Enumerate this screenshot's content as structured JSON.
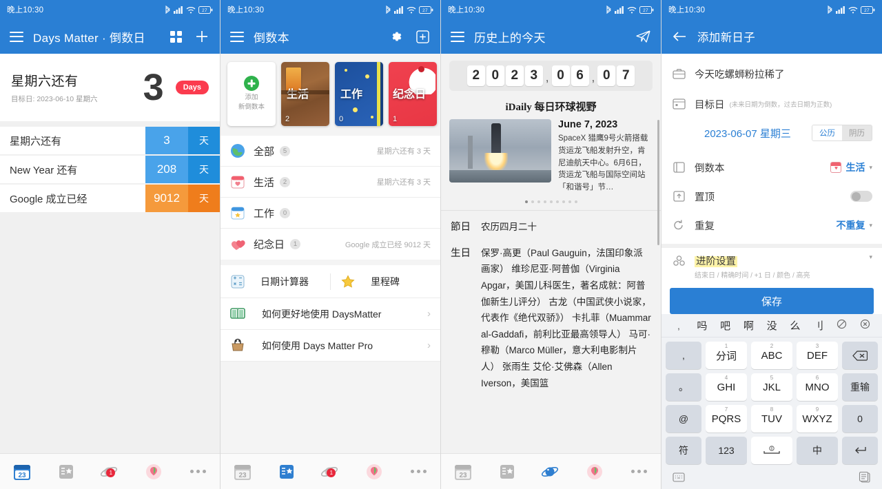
{
  "status_bar": {
    "time": "晚上10:30",
    "battery": "27",
    "icons": [
      "bluetooth-icon",
      "signal-icon",
      "wifi-icon",
      "battery-icon"
    ]
  },
  "panel1": {
    "appbar": {
      "title": "Days Matter · 倒数日",
      "menu_icon": "hamburger-icon",
      "grid_icon": "grid-view-icon",
      "add_icon": "plus-icon"
    },
    "hero": {
      "title": "星期六还有",
      "subtitle": "目标日: 2023-06-10 星期六",
      "number": "3",
      "pill": "Days"
    },
    "rows": [
      {
        "label": "星期六还有",
        "value": "3",
        "unit": "天",
        "num_bg": "#49a3ea",
        "unit_bg": "#1f8ddb"
      },
      {
        "label": "New Year 还有",
        "value": "208",
        "unit": "天",
        "num_bg": "#49a3ea",
        "unit_bg": "#1f8ddb"
      },
      {
        "label": "Google 成立已经",
        "value": "9012",
        "unit": "天",
        "num_bg": "#f59a3c",
        "unit_bg": "#ef7d1c"
      }
    ],
    "dock": {
      "items": [
        "calendar-23-icon",
        "star-book-icon",
        "planet-icon",
        "balloon-icon",
        "more-dots-icon"
      ],
      "badge": "1"
    }
  },
  "panel2": {
    "appbar": {
      "title": "倒数本",
      "menu_icon": "hamburger-icon",
      "settings_icon": "gear-icon",
      "add_icon": "plus-box-icon"
    },
    "books": [
      {
        "name": "添加",
        "name2": "新倒数本",
        "type": "add"
      },
      {
        "name": "生活",
        "count": "2",
        "type": "life"
      },
      {
        "name": "工作",
        "count": "0",
        "type": "work"
      },
      {
        "name": "纪念日",
        "count": "1",
        "type": "anniversary"
      }
    ],
    "categories": [
      {
        "icon": "globe-icon",
        "name": "全部",
        "badge": "5",
        "right": "星期六还有 3 天"
      },
      {
        "icon": "calendar-heart-icon",
        "name": "生活",
        "badge": "2",
        "right": "星期六还有 3 天"
      },
      {
        "icon": "calendar-star-icon",
        "name": "工作",
        "badge": "0",
        "right": ""
      },
      {
        "icon": "hearts-icon",
        "name": "纪念日",
        "badge": "1",
        "right": "Google 成立已经 9012 天"
      }
    ],
    "tools": [
      {
        "icon": "calculator-icon",
        "label": "日期计算器"
      },
      {
        "icon": "star-icon",
        "label": "里程碑"
      }
    ],
    "links": [
      {
        "icon": "book-icon",
        "label": "如何更好地使用 DaysMatter",
        "chevron": "›"
      },
      {
        "icon": "bag-icon",
        "label": "如何使用 Days Matter Pro",
        "chevron": "›"
      }
    ],
    "dock": {
      "items": [
        "calendar-23-icon",
        "star-book-icon",
        "planet-icon",
        "balloon-icon",
        "more-dots-icon"
      ],
      "badge": "1"
    }
  },
  "panel3": {
    "appbar": {
      "title": "历史上的今天",
      "menu_icon": "hamburger-icon",
      "send_icon": "paper-plane-icon"
    },
    "date_digits": [
      "2",
      "0",
      "2",
      "3",
      "0",
      "6",
      "0",
      "7"
    ],
    "date_sep": ",",
    "news": {
      "source": "iDaily 每日环球视野",
      "date": "June 7, 2023",
      "body": "SpaceX 猎鹰9号火箭搭载货运龙飞船发射升空，肯尼迪航天中心。6月6日，货运龙飞船与国际空间站「和谐号」节…",
      "image": "rocket-launch-photo",
      "dots_total": 9,
      "dots_active": 1
    },
    "entries": [
      {
        "key": "節日",
        "value": "农历四月二十"
      },
      {
        "key": "生日",
        "value": "保罗·高更（Paul Gauguin，法国印象派画家）\n维珍尼亚·阿普伽（Virginia Apgar，美国儿科医生，著名成就：阿普伽新生儿评分）\n古龙（中国武侠小说家，代表作《绝代双骄》）\n卡扎菲（Muammar al-Gaddafi，前利比亚最高领导人）\n马可·穆勒（Marco Müller，意大利电影制片人）\n张雨生\n艾伦·艾佛森（Allen Iverson，美国篮"
      }
    ],
    "dock": {
      "items": [
        "calendar-23-icon",
        "star-book-icon",
        "planet-icon",
        "balloon-icon",
        "more-dots-icon"
      ]
    }
  },
  "panel4": {
    "appbar": {
      "title": "添加新日子",
      "back_icon": "arrow-left-icon"
    },
    "title_field": {
      "icon": "briefcase-icon",
      "value": "今天吃螺蛳粉拉稀了"
    },
    "target": {
      "icon": "calendar-box-icon",
      "label": "目标日",
      "hint": "(未来日期为倒数，过去日期为正数)",
      "date": "2023-06-07 星期三",
      "calendar_types": [
        {
          "label": "公历",
          "selected": true
        },
        {
          "label": "阴历",
          "selected": false
        }
      ]
    },
    "book": {
      "icon": "book-outline-icon",
      "label": "倒数本",
      "value": "生活",
      "caret": "▾"
    },
    "pin": {
      "icon": "pin-top-icon",
      "label": "置顶",
      "state": "off"
    },
    "repeat": {
      "icon": "repeat-icon",
      "label": "重复",
      "value": "不重复",
      "caret": "▾"
    },
    "advanced": {
      "icon": "advanced-icon",
      "label": "进阶设置",
      "sub": "结束日 / 精确时间 / +1 日 / 颜色 / 高亮",
      "caret": "▾"
    },
    "save_label": "保存",
    "keyboard": {
      "suggestions": [
        ",",
        "吗",
        "吧",
        "啊",
        "没",
        "么",
        "刂",
        "close-slash-icon",
        "clear-x-icon"
      ],
      "rows": [
        [
          {
            "l": ",",
            "fn": true
          },
          {
            "l": "分词",
            "sup": "1"
          },
          {
            "l": "ABC",
            "sup": "2"
          },
          {
            "l": "DEF",
            "sup": "3"
          },
          {
            "l": "backspace-icon",
            "fn": true
          }
        ],
        [
          {
            "l": "。",
            "fn": true
          },
          {
            "l": "GHI",
            "sup": "4"
          },
          {
            "l": "JKL",
            "sup": "5"
          },
          {
            "l": "MNO",
            "sup": "6"
          },
          {
            "l": "重输",
            "fn": true
          }
        ],
        [
          {
            "l": "@",
            "fn": true
          },
          {
            "l": "PQRS",
            "sup": "7"
          },
          {
            "l": "TUV",
            "sup": "8"
          },
          {
            "l": "WXYZ",
            "sup": "9"
          },
          {
            "l": "0",
            "fn": true
          }
        ],
        [
          {
            "l": "?",
            "fn": true
          },
          {
            "l": "",
            "sup": ""
          }
        ]
      ],
      "bottom_row": [
        {
          "l": "符",
          "fn": true
        },
        {
          "l": "123",
          "fn": true
        },
        {
          "l": "space-icon",
          "fn": false
        },
        {
          "l": "中",
          "fn": true
        },
        {
          "l": "enter-icon",
          "fn": true
        }
      ],
      "bottom_bar": [
        "keyboard-switch-icon",
        "clipboard-icon"
      ]
    }
  },
  "colors": {
    "brand": "#2a7fd4",
    "accent_red": "#fb3b4e",
    "accent_orange": "#ef7d1c",
    "accent_blue": "#1f8ddb",
    "green": "#2fb24c"
  }
}
